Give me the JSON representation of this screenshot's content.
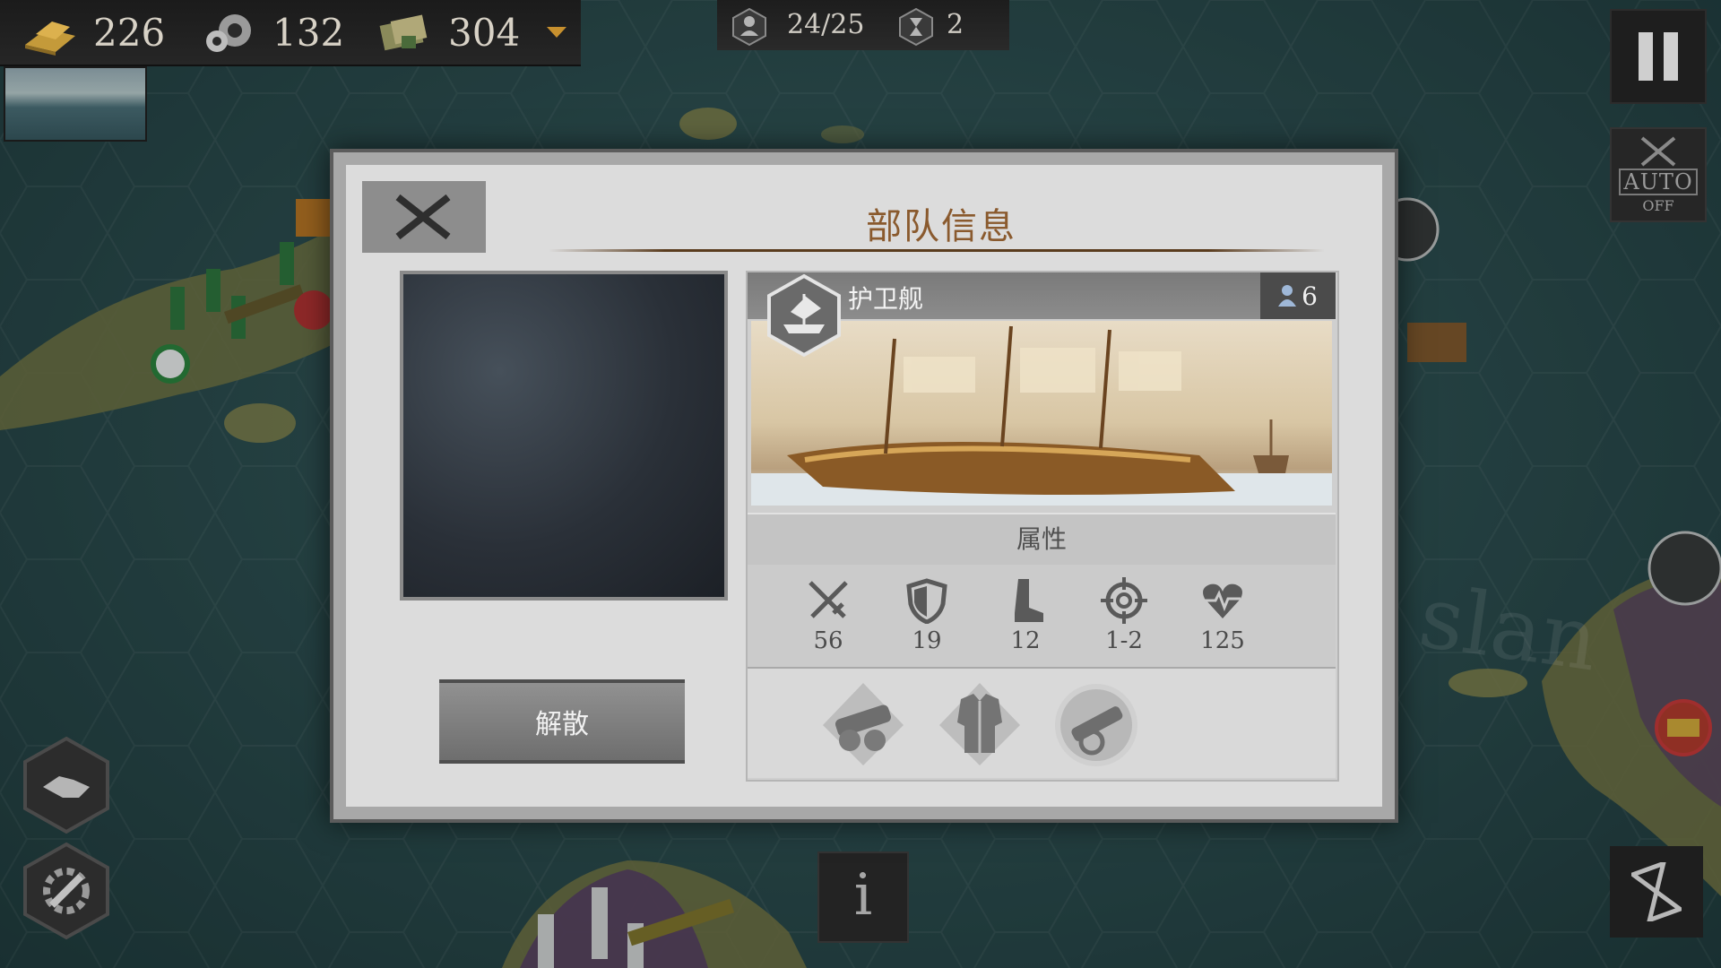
{
  "resources": [
    {
      "name": "gold",
      "icon": "gold-bars-icon",
      "value": "226"
    },
    {
      "name": "industry",
      "icon": "gears-icon",
      "value": "132"
    },
    {
      "name": "command",
      "icon": "scroll-icon",
      "value": "304"
    }
  ],
  "turn": {
    "units": "24/25",
    "wait": "2"
  },
  "auto_button": {
    "label": "AUTO",
    "state": "OFF"
  },
  "info_button": {
    "label": "i"
  },
  "dialog": {
    "title": "部队信息",
    "disband_label": "解散",
    "unit": {
      "name": "护卫舰",
      "count": "6",
      "icon": "ship-icon",
      "attributes_label": "属性",
      "stats": [
        {
          "name": "attack",
          "icon": "crossed-swords-icon",
          "value": "56"
        },
        {
          "name": "defense",
          "icon": "shield-icon",
          "value": "19"
        },
        {
          "name": "movement",
          "icon": "boot-icon",
          "value": "12"
        },
        {
          "name": "range",
          "icon": "crosshair-icon",
          "value": "1-2"
        },
        {
          "name": "health",
          "icon": "heart-icon",
          "value": "125"
        }
      ],
      "skills": [
        {
          "icon": "cannon-skill-icon"
        },
        {
          "icon": "armor-skill-icon"
        },
        {
          "icon": "artillery-skill-icon"
        }
      ]
    }
  },
  "colors": {
    "title": "#8a5a2e",
    "dialog_bg": "#dcdcdc",
    "header_gray": "#7a7a7a"
  }
}
